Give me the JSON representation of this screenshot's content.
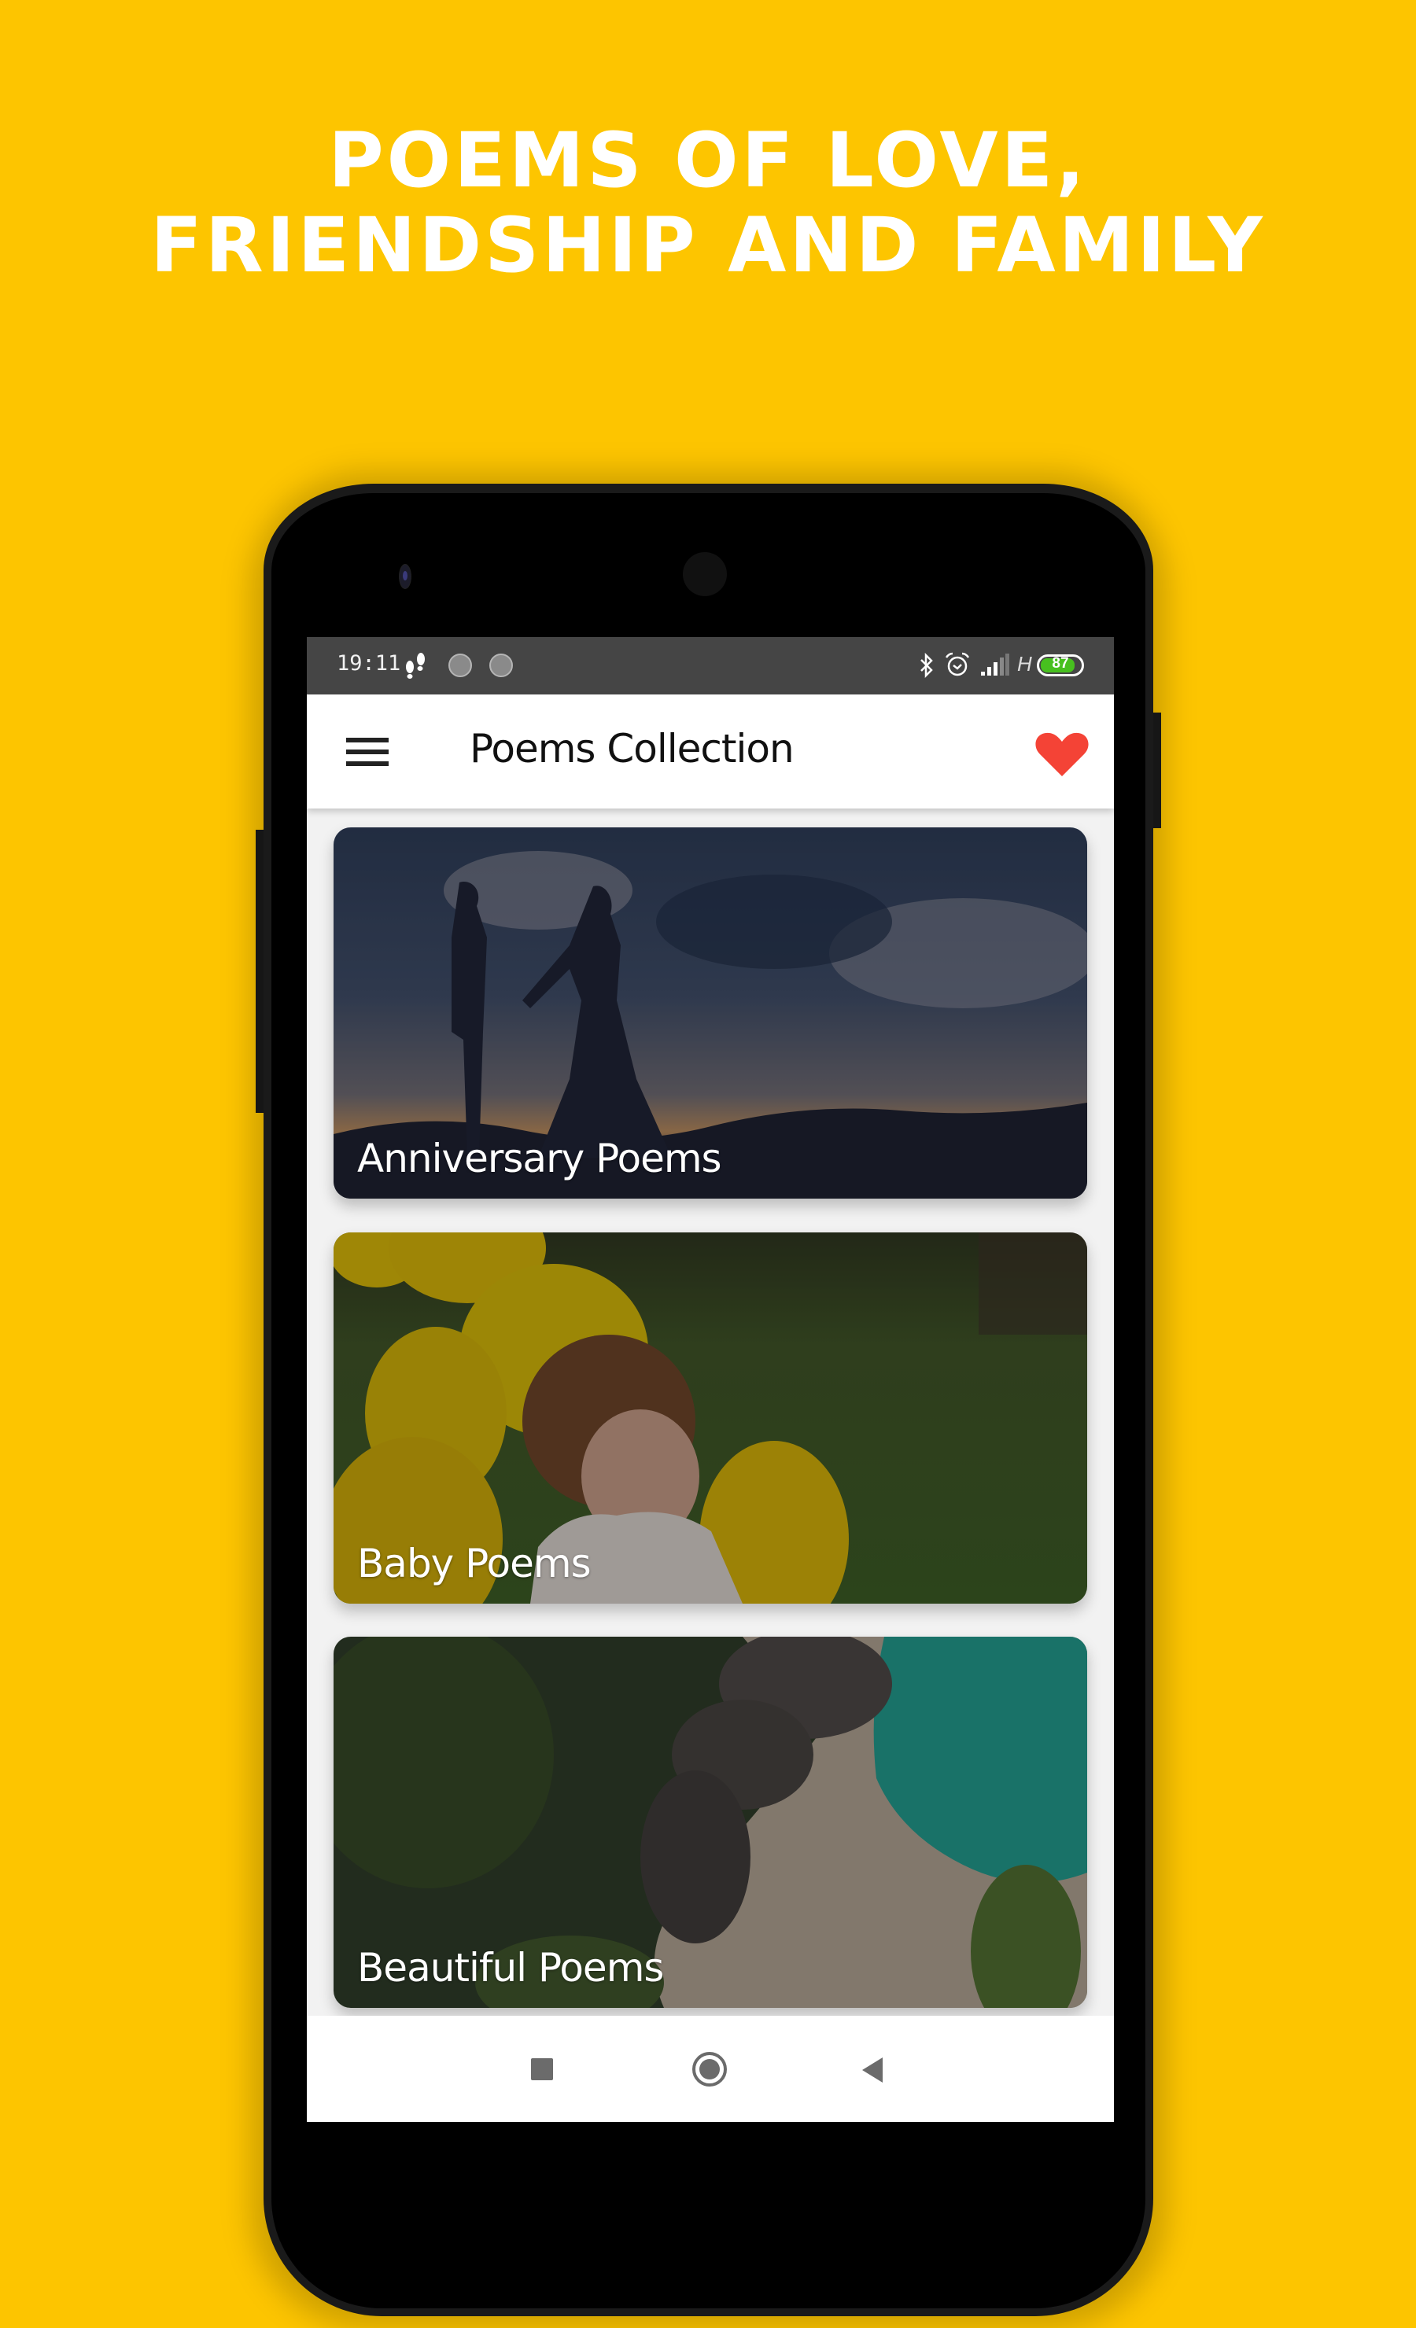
{
  "promo": {
    "headline_line1": "POEMS OF LOVE,",
    "headline_line2": "FRIENDSHIP AND FAMILY",
    "background_color": "#fdc500"
  },
  "status_bar": {
    "time": "19:11",
    "left_icons": [
      "footsteps-icon",
      "notification-circle-icon",
      "notification-circle-icon"
    ],
    "right_icons": [
      "bluetooth-icon",
      "alarm-icon",
      "signal-icon"
    ],
    "network_type": "H",
    "battery_percent": 87
  },
  "app_bar": {
    "title": "Poems Collection",
    "menu_icon": "hamburger-menu-icon",
    "favorites_icon": "heart-icon",
    "accent_color": "#f44336"
  },
  "categories": [
    {
      "label": "Anniversary Poems",
      "image": "couple-silhouette-sunset"
    },
    {
      "label": "Baby Poems",
      "image": "toddler-with-yellow-balloons"
    },
    {
      "label": "Beautiful Poems",
      "image": "tropical-beach-aerial"
    }
  ],
  "nav_bar": {
    "recents": "recents-square-icon",
    "home": "home-circle-icon",
    "back": "back-triangle-icon"
  }
}
